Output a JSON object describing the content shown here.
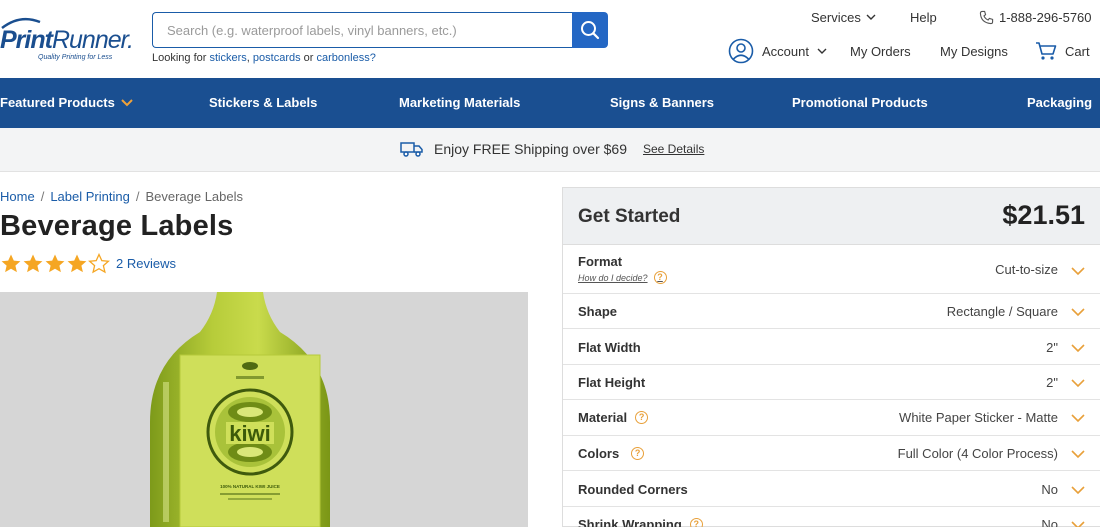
{
  "brand": {
    "name_bold": "Print",
    "name_thin": "Runner.",
    "tagline": "Quality Printing for Less"
  },
  "search": {
    "placeholder": "Search (e.g. waterproof labels, vinyl banners, etc.)",
    "value": "",
    "looking_prefix": "Looking for",
    "link1": "stickers",
    "link2": "postcards",
    "or_text": "or",
    "link3": "carbonless?"
  },
  "top_links": {
    "services": "Services",
    "help": "Help",
    "phone": "1-888-296-5760"
  },
  "account_row": {
    "account": "Account",
    "my_orders": "My Orders",
    "my_designs": "My Designs",
    "cart": "Cart"
  },
  "nav": {
    "items": [
      "Featured Products",
      "Stickers & Labels",
      "Marketing Materials",
      "Signs & Banners",
      "Promotional Products",
      "Packaging"
    ]
  },
  "shipping": {
    "text": "Enjoy FREE Shipping over $69",
    "link": "See Details"
  },
  "breadcrumb": {
    "home": "Home",
    "label_printing": "Label Printing",
    "current": "Beverage Labels",
    "separator": "/"
  },
  "product": {
    "title": "Beverage Labels",
    "rating": 4,
    "rating_max": 5,
    "reviews": "2 Reviews",
    "bottle_label_text": "kiwi",
    "bottle_label_small": "100% NATURAL KIWI JUICE"
  },
  "panel": {
    "title": "Get Started",
    "price": "$21.51",
    "options": [
      {
        "label": "Format",
        "sub": "How do I decide?",
        "value": "Cut-to-size"
      },
      {
        "label": "Shape",
        "value": "Rectangle / Square"
      },
      {
        "label": "Flat Width",
        "value": "2\""
      },
      {
        "label": "Flat Height",
        "value": "2\""
      },
      {
        "label": "Material",
        "value": "White Paper Sticker - Matte"
      },
      {
        "label": "Colors",
        "value": "Full Color (4 Color Process)"
      },
      {
        "label": "Rounded Corners",
        "value": "No"
      },
      {
        "label": "Shrink Wrapping",
        "value": "No"
      }
    ]
  },
  "colors": {
    "brand_blue": "#1a4f91",
    "link_blue": "#1a5ca8",
    "accent_orange": "#e8a03a",
    "star_orange": "#f5a623"
  }
}
